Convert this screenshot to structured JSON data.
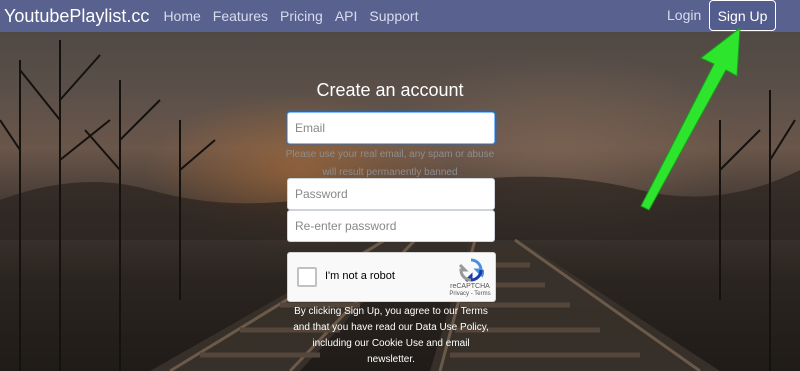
{
  "navbar": {
    "brand": "YoutubePlaylist.cc",
    "links": [
      "Home",
      "Features",
      "Pricing",
      "API",
      "Support"
    ],
    "login": "Login",
    "signup": "Sign Up"
  },
  "form": {
    "title": "Create an account",
    "email_placeholder": "Email",
    "email_hint_line1": "Please use your real email, any spam or abuse",
    "email_hint_line2": "will result permanently banned",
    "password_placeholder": "Password",
    "reenter_placeholder": "Re-enter password",
    "captcha": {
      "label": "I'm not a robot",
      "brand": "reCAPTCHA",
      "links": "Privacy - Terms"
    },
    "terms_lines": [
      "By clicking Sign Up, you agree to our Terms",
      "and that you have read our Data Use Policy,",
      "including our Cookie Use and email",
      "newsletter."
    ]
  },
  "colors": {
    "navbar": "#5a6496",
    "arrow": "#2ee52e",
    "focus_border": "#80bdff"
  }
}
